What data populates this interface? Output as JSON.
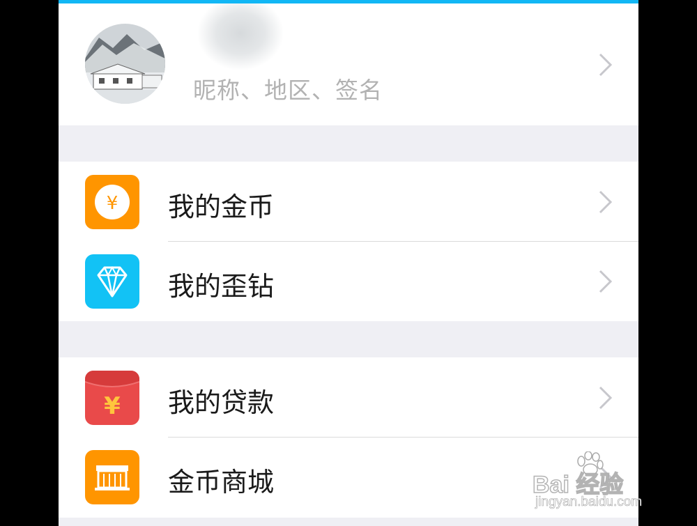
{
  "profile": {
    "subtitle": "昵称、地区、签名",
    "avatar_icon": "profile-photo-snowy-house"
  },
  "menu_group_1": [
    {
      "label": "我的金币",
      "icon": "gold-coin-icon",
      "color": "#ff9500"
    },
    {
      "label": "我的歪钻",
      "icon": "diamond-icon",
      "color": "#12c2f5"
    }
  ],
  "menu_group_2": [
    {
      "label": "我的贷款",
      "icon": "red-envelope-icon",
      "color": "#e94a4a"
    },
    {
      "label": "金币商城",
      "icon": "store-icon",
      "color": "#ff9500"
    }
  ],
  "watermark": {
    "logo_text": "Bai 经验",
    "url": "jingyan.baidu.com"
  },
  "colors": {
    "accent": "#12b7f5",
    "background": "#efeff4",
    "chevron": "#c7c7cc"
  }
}
